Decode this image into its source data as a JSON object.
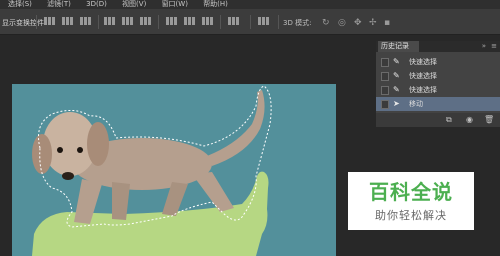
{
  "menubar": {
    "items": [
      "选择(S)",
      "滤镜(T)",
      "3D(D)",
      "视图(V)",
      "窗口(W)",
      "帮助(H)"
    ]
  },
  "options_bar": {
    "transform_controls_label": "显示变换控件",
    "mode_3d_label": "3D 模式:"
  },
  "history_panel": {
    "title": "历史记录",
    "items": [
      {
        "label": "快速选择",
        "icon": "quick-selection-icon",
        "selected": false
      },
      {
        "label": "快速选择",
        "icon": "quick-selection-icon",
        "selected": false
      },
      {
        "label": "快速选择",
        "icon": "quick-selection-icon",
        "selected": false
      },
      {
        "label": "移动",
        "icon": "move-icon",
        "selected": true
      }
    ]
  },
  "watermark": {
    "title": "百科全说",
    "subtitle": "助你轻松解决"
  },
  "colors": {
    "canvas_background": "#53909b",
    "green_shape": "#b6d783",
    "history_selected": "#5e6f86",
    "watermark_green": "#4caf50"
  }
}
